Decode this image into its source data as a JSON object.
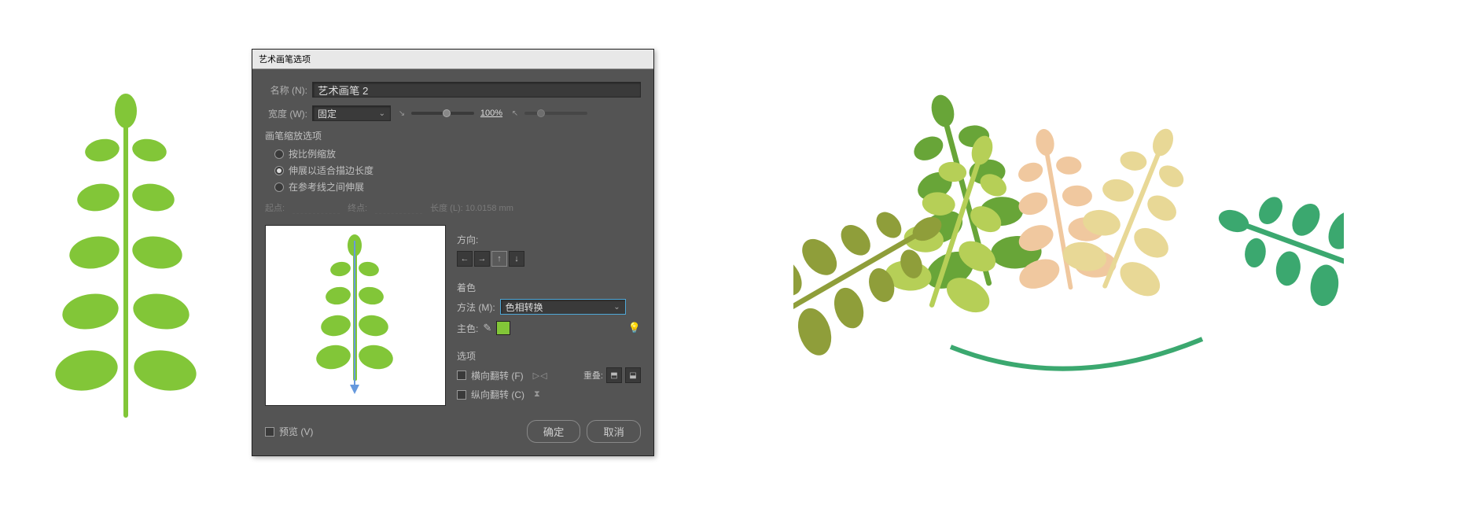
{
  "dialog": {
    "title": "艺术画笔选项",
    "name_label": "名称 (N):",
    "name_value": "艺术画笔 2",
    "width_label": "宽度 (W):",
    "width_mode": "固定",
    "width_value": "100%",
    "scale_section": "画笔缩放选项",
    "scale_option1": "按比例缩放",
    "scale_option2": "伸展以适合描边长度",
    "scale_option3": "在参考线之间伸展",
    "scale_selected": 1,
    "start_label": "起点:",
    "end_label": "终点:",
    "length_label": "长度 (L): 10.0158 mm",
    "direction_label": "方向:",
    "colorization_label": "着色",
    "method_label": "方法 (M):",
    "method_value": "色相转换",
    "key_color_label": "主色:",
    "key_color": "#82c638",
    "options_label": "选项",
    "flip_along_label": "横向翻转 (F)",
    "flip_across_label": "纵向翻转 (C)",
    "overlap_label": "重叠:",
    "preview_label": "预览 (V)",
    "ok_label": "确定",
    "cancel_label": "取消"
  },
  "plant_color": "#82c638",
  "right_plants_colors": [
    "#68a538",
    "#b6cf57",
    "#f0c89f",
    "#8f9e3a",
    "#e8d896",
    "#3ba86f"
  ]
}
